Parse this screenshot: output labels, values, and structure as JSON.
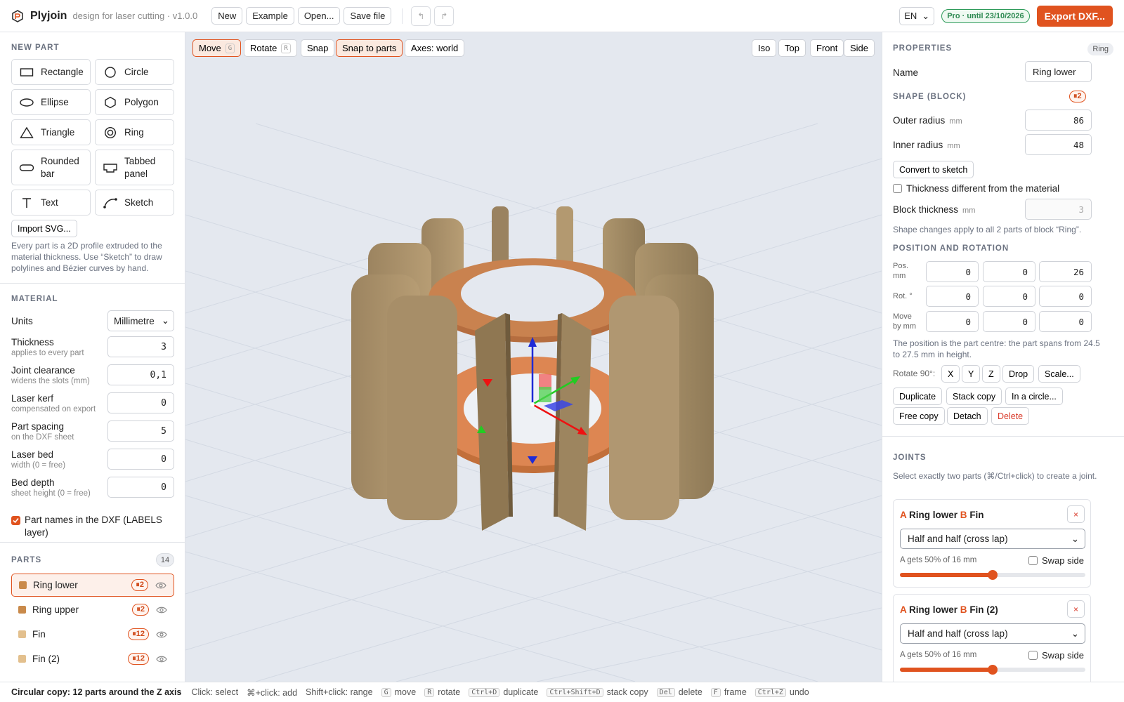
{
  "app": {
    "name": "Plyjoin",
    "subtitle": "design for laser cutting · v1.0.0"
  },
  "toolbar": {
    "new": "New",
    "example": "Example",
    "open": "Open...",
    "save": "Save file",
    "language": "EN",
    "pro_badge": "Pro · until 23/10/2026",
    "export": "Export DXF..."
  },
  "new_part": {
    "title": "NEW PART",
    "shapes": [
      "Rectangle",
      "Circle",
      "Ellipse",
      "Polygon",
      "Triangle",
      "Ring",
      "Rounded bar",
      "Tabbed panel",
      "Text",
      "Sketch"
    ],
    "import": "Import SVG...",
    "help": "Every part is a 2D profile extruded to the material thickness. Use “Sketch” to draw polylines and Bézier curves by hand."
  },
  "material": {
    "title": "MATERIAL",
    "units_label": "Units",
    "units_value": "Millimetre",
    "thickness_label": "Thickness",
    "thickness_sub": "applies to every part",
    "thickness_value": "3",
    "clearance_label": "Joint clearance",
    "clearance_sub": "widens the slots (mm)",
    "clearance_value": "0,1",
    "kerf_label": "Laser kerf",
    "kerf_sub": "compensated on export",
    "kerf_value": "0",
    "spacing_label": "Part spacing",
    "spacing_sub": "on the DXF sheet",
    "spacing_value": "5",
    "bed_label": "Laser bed",
    "bed_sub": "width (0 = free)",
    "bed_value": "0",
    "depth_label": "Bed depth",
    "depth_sub": "sheet height (0 = free)",
    "depth_value": "0",
    "labels_checkbox": "Part names in the DXF (LABELS layer)",
    "labels_checked": true
  },
  "parts": {
    "title": "PARTS",
    "count": "14",
    "items": [
      {
        "name": "Ring lower",
        "badge": "⏸2",
        "color": "#c98a4b",
        "active": true
      },
      {
        "name": "Ring upper",
        "badge": "⏸2",
        "color": "#c98a4b",
        "active": false
      },
      {
        "name": "Fin",
        "badge": "⏸12",
        "color": "#e3c08e",
        "active": false
      },
      {
        "name": "Fin (2)",
        "badge": "⏸12",
        "color": "#e3c08e",
        "active": false
      }
    ]
  },
  "viewport": {
    "move": "Move",
    "move_key": "G",
    "rotate": "Rotate",
    "rotate_key": "R",
    "snap": "Snap",
    "snap_parts": "Snap to parts",
    "axes": "Axes: world",
    "iso": "Iso",
    "top": "Top",
    "front": "Front",
    "side": "Side"
  },
  "properties": {
    "title": "PROPERTIES",
    "kind": "Ring",
    "name_label": "Name",
    "name_value": "Ring lower",
    "shape_title": "SHAPE (BLOCK)",
    "shape_badge": "⏸2",
    "outer_label": "Outer radius",
    "outer_value": "86",
    "inner_label": "Inner radius",
    "inner_value": "48",
    "unit": "mm",
    "convert": "Convert to sketch",
    "thickness_diff": "Thickness different from the material",
    "block_thickness_label": "Block thickness",
    "block_thickness_value": "3",
    "block_note": "Shape changes apply to all 2 parts of block “Ring”.",
    "pos_title": "POSITION AND ROTATION",
    "pos_label": "Pos.",
    "pos_unit": "mm",
    "pos": [
      "0",
      "0",
      "26"
    ],
    "rot_label": "Rot. °",
    "rot": [
      "0",
      "0",
      "0"
    ],
    "move_label": "Move",
    "move_unit": "by mm",
    "move": [
      "0",
      "0",
      "0"
    ],
    "pos_note": "The position is the part centre: the part spans from 24.5 to 27.5 mm in height.",
    "rotate90_label": "Rotate 90°:",
    "rx": "X",
    "ry": "Y",
    "rz": "Z",
    "drop": "Drop",
    "scale": "Scale...",
    "duplicate": "Duplicate",
    "stack_copy": "Stack copy",
    "in_circle": "In a circle...",
    "free_copy": "Free copy",
    "detach": "Detach",
    "delete": "Delete"
  },
  "joints": {
    "title": "JOINTS",
    "help": "Select exactly two parts (⌘/Ctrl+click) to create a joint.",
    "items": [
      {
        "a_tag": "A",
        "a": "Ring lower",
        "b_tag": "B",
        "b": "Fin",
        "type": "Half and half (cross lap)",
        "info": "A gets 50% of 16 mm",
        "swap": "Swap side",
        "ratio": 0.5
      },
      {
        "a_tag": "A",
        "a": "Ring lower",
        "b_tag": "B",
        "b": "Fin (2)",
        "type": "Half and half (cross lap)",
        "info": "A gets 50% of 16 mm",
        "swap": "Swap side",
        "ratio": 0.5
      }
    ]
  },
  "status": {
    "message": "Circular copy: 12 parts around the Z axis",
    "click": "Click: select",
    "cmd_click": "⌘+click: add",
    "shift_click": "Shift+click: range",
    "keys": [
      {
        "key": "G",
        "label": "move"
      },
      {
        "key": "R",
        "label": "rotate"
      },
      {
        "key": "Ctrl+D",
        "label": "duplicate"
      },
      {
        "key": "Ctrl+Shift+D",
        "label": "stack copy"
      },
      {
        "key": "Del",
        "label": "delete"
      },
      {
        "key": "F",
        "label": "frame"
      },
      {
        "key": "Ctrl+Z",
        "label": "undo"
      }
    ]
  }
}
